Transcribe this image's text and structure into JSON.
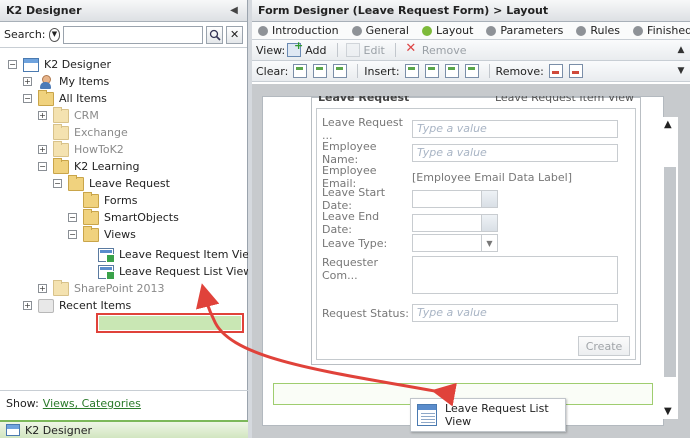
{
  "left_pane": {
    "title": "K2 Designer",
    "search_label": "Search:",
    "search_placeholder": "",
    "tree": [
      {
        "label": "K2 Designer",
        "icon": "designer-icon"
      },
      {
        "label": "My Items",
        "icon": "user-icon"
      },
      {
        "label": "All Items",
        "icon": "folder-icon"
      },
      {
        "label": "CRM",
        "icon": "folder-icon"
      },
      {
        "label": "Exchange",
        "icon": "folder-icon"
      },
      {
        "label": "HowToK2",
        "icon": "folder-icon"
      },
      {
        "label": "K2 Learning",
        "icon": "folder-icon"
      },
      {
        "label": "Leave Request",
        "icon": "folder-icon"
      },
      {
        "label": "Forms",
        "icon": "folder-icon"
      },
      {
        "label": "SmartObjects",
        "icon": "folder-icon"
      },
      {
        "label": "Views",
        "icon": "folder-icon"
      },
      {
        "label": "Leave Request Item View",
        "icon": "view-icon"
      },
      {
        "label": "Leave Request List View",
        "icon": "view-icon",
        "selected": true
      },
      {
        "label": "SharePoint 2013",
        "icon": "folder-icon"
      },
      {
        "label": "Recent Items",
        "icon": "recent-icon"
      }
    ],
    "show_label": "Show:",
    "show_link": "Views, Categories",
    "bottom_tab": "K2 Designer"
  },
  "right_pane": {
    "title": "Form Designer (Leave Request Form) > Layout",
    "steps": [
      "Introduction",
      "General",
      "Layout",
      "Parameters",
      "Rules",
      "Finished"
    ],
    "active_step": "Layout",
    "toolbar1": {
      "view_label": "View:",
      "add": "Add",
      "edit": "Edit",
      "remove": "Remove"
    },
    "toolbar2": {
      "clear_label": "Clear:",
      "insert_label": "Insert:",
      "remove_label": "Remove:"
    }
  },
  "form_view": {
    "title": "Leave Request",
    "view_name": "Leave Request Item View",
    "fields": {
      "leave_request": {
        "label": "Leave Request ...",
        "placeholder": "Type a value"
      },
      "employee_name": {
        "label": "Employee Name:",
        "placeholder": "Type a value"
      },
      "employee_email": {
        "label": "Employee Email:",
        "value": "[Employee Email Data Label]"
      },
      "leave_start": {
        "label": "Leave Start Date:"
      },
      "leave_end": {
        "label": "Leave End Date:"
      },
      "leave_type": {
        "label": "Leave Type:"
      },
      "requester_comments": {
        "label": "Requester Com..."
      },
      "request_status": {
        "label": "Request Status:",
        "placeholder": "Type a value"
      }
    },
    "create_button": "Create"
  },
  "drag_ghost": {
    "label": "Leave Request List View"
  },
  "colors": {
    "accent_green": "#7dba3a",
    "highlight_red": "#e0423a",
    "selection_green": "#c9e7b4"
  }
}
